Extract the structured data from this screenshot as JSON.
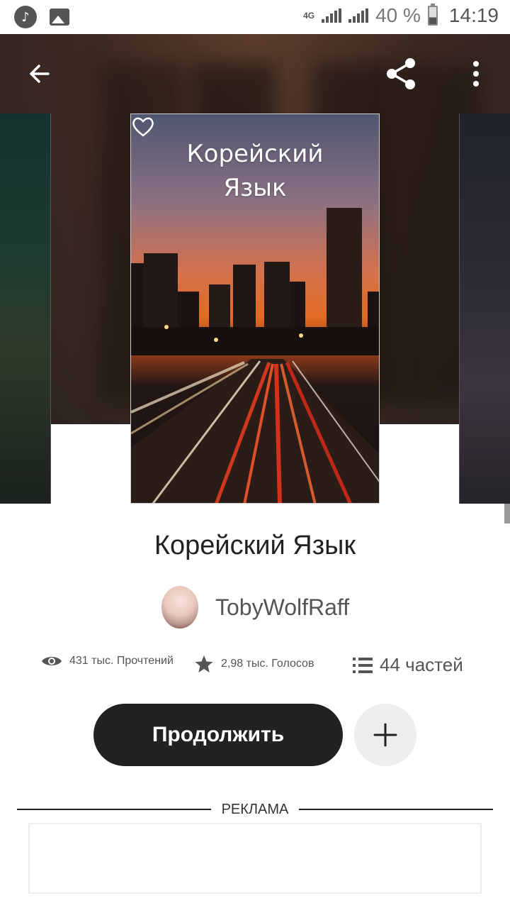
{
  "status_bar": {
    "network": "4G",
    "battery_percent": "40 %",
    "time": "14:19",
    "left_icons": [
      "tiktok-icon",
      "gallery-icon"
    ]
  },
  "top_bar": {
    "icons": [
      "back-arrow-icon",
      "share-icon",
      "more-vertical-icon"
    ],
    "icon_color": "#ffffff"
  },
  "cover": {
    "title_line1": "Корейский",
    "title_line2": "Язык",
    "heart_icon": "heart-outline-icon"
  },
  "book": {
    "title": "Корейский Язык",
    "author": "TobyWolfRaff"
  },
  "stats": {
    "reads": "431 тыс. Прочтений",
    "votes": "2,98 тыс. Голосов",
    "parts": "44 частей"
  },
  "actions": {
    "continue_label": "Продолжить",
    "add_icon": "plus-icon"
  },
  "ad": {
    "label": "РЕКЛАМА"
  },
  "colors": {
    "primary_button": "#222222",
    "hero_background": "#3e2a22"
  }
}
